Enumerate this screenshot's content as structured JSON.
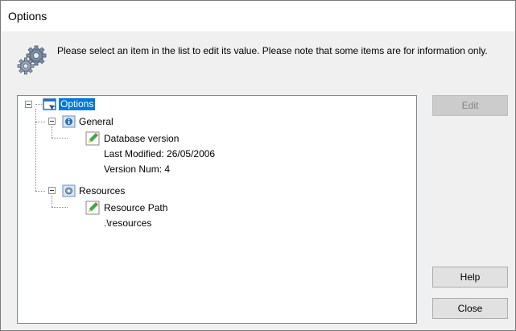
{
  "window": {
    "title": "Options"
  },
  "message": "Please select an item in the list to edit its value. Please note that some items are for information only.",
  "tree": {
    "root": {
      "label": "Options",
      "selected": true,
      "icon": "options-window-icon"
    },
    "general": {
      "label": "General",
      "icon": "info-folder-icon",
      "item": {
        "label": "Database version",
        "icon": "edit-pencil-icon",
        "details": [
          "Last Modified: 26/05/2006",
          "Version Num: 4"
        ]
      }
    },
    "resources": {
      "label": "Resources",
      "icon": "resources-gear-icon",
      "item": {
        "label": "Resource Path",
        "icon": "edit-pencil-icon",
        "details": [
          ".\\resources"
        ]
      }
    }
  },
  "buttons": {
    "edit": {
      "label": "Edit",
      "enabled": false
    },
    "help": {
      "label": "Help"
    },
    "close": {
      "label": "Close"
    }
  },
  "colors": {
    "selection": "#0078d7",
    "dialog_bg": "#f0f0f0",
    "button_bg": "#e1e1e1"
  }
}
